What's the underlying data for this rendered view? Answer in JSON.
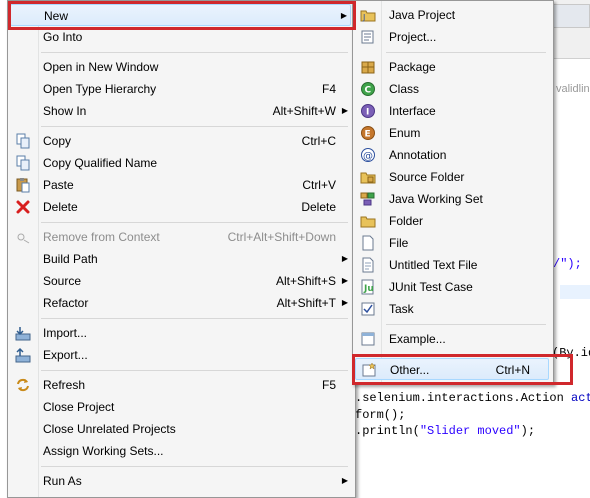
{
  "editor": {
    "grey_text": "validlin",
    "code_line_1_str": "/\");",
    "code_line_2": "(By.id",
    "code_line_3_a": ".selenium.interactions.Action ",
    "code_line_3_b": "acti",
    "code_line_4": "form();",
    "code_line_5_a": ".println(",
    "code_line_5_str": "\"Slider moved\"",
    "code_line_5_b": ");",
    "obscured_line": "Ctrl+N"
  },
  "main_menu": {
    "items": [
      {
        "label": "New",
        "shortcut": "",
        "submenu": true
      },
      {
        "label": "Go Into",
        "shortcut": ""
      },
      {
        "label": "Open in New Window",
        "shortcut": ""
      },
      {
        "label": "Open Type Hierarchy",
        "shortcut": "F4"
      },
      {
        "label": "Show In",
        "shortcut": "Alt+Shift+W",
        "submenu": true
      },
      {
        "label": "Copy",
        "shortcut": "Ctrl+C"
      },
      {
        "label": "Copy Qualified Name",
        "shortcut": ""
      },
      {
        "label": "Paste",
        "shortcut": "Ctrl+V"
      },
      {
        "label": "Delete",
        "shortcut": "Delete"
      },
      {
        "label": "Remove from Context",
        "shortcut": "Ctrl+Alt+Shift+Down",
        "disabled": true
      },
      {
        "label": "Build Path",
        "shortcut": "",
        "submenu": true
      },
      {
        "label": "Source",
        "shortcut": "Alt+Shift+S",
        "submenu": true
      },
      {
        "label": "Refactor",
        "shortcut": "Alt+Shift+T",
        "submenu": true
      },
      {
        "label": "Import...",
        "shortcut": ""
      },
      {
        "label": "Export...",
        "shortcut": ""
      },
      {
        "label": "Refresh",
        "shortcut": "F5"
      },
      {
        "label": "Close Project",
        "shortcut": ""
      },
      {
        "label": "Close Unrelated Projects",
        "shortcut": ""
      },
      {
        "label": "Assign Working Sets...",
        "shortcut": ""
      },
      {
        "label": "Run As",
        "shortcut": "",
        "submenu": true
      }
    ]
  },
  "sub_menu": {
    "items": [
      {
        "label": "Java Project"
      },
      {
        "label": "Project..."
      },
      {
        "label": "Package"
      },
      {
        "label": "Class"
      },
      {
        "label": "Interface"
      },
      {
        "label": "Enum"
      },
      {
        "label": "Annotation"
      },
      {
        "label": "Source Folder"
      },
      {
        "label": "Java Working Set"
      },
      {
        "label": "Folder"
      },
      {
        "label": "File"
      },
      {
        "label": "Untitled Text File"
      },
      {
        "label": "JUnit Test Case"
      },
      {
        "label": "Task"
      },
      {
        "label": "Example..."
      },
      {
        "label": "Other...",
        "shortcut": "Ctrl+N"
      }
    ]
  },
  "colors": {
    "highlight_box": "#d0282c",
    "menu_bg": "#f5f5f5",
    "hover_bg": "#dcebfc",
    "string_color": "#2a00ff"
  }
}
